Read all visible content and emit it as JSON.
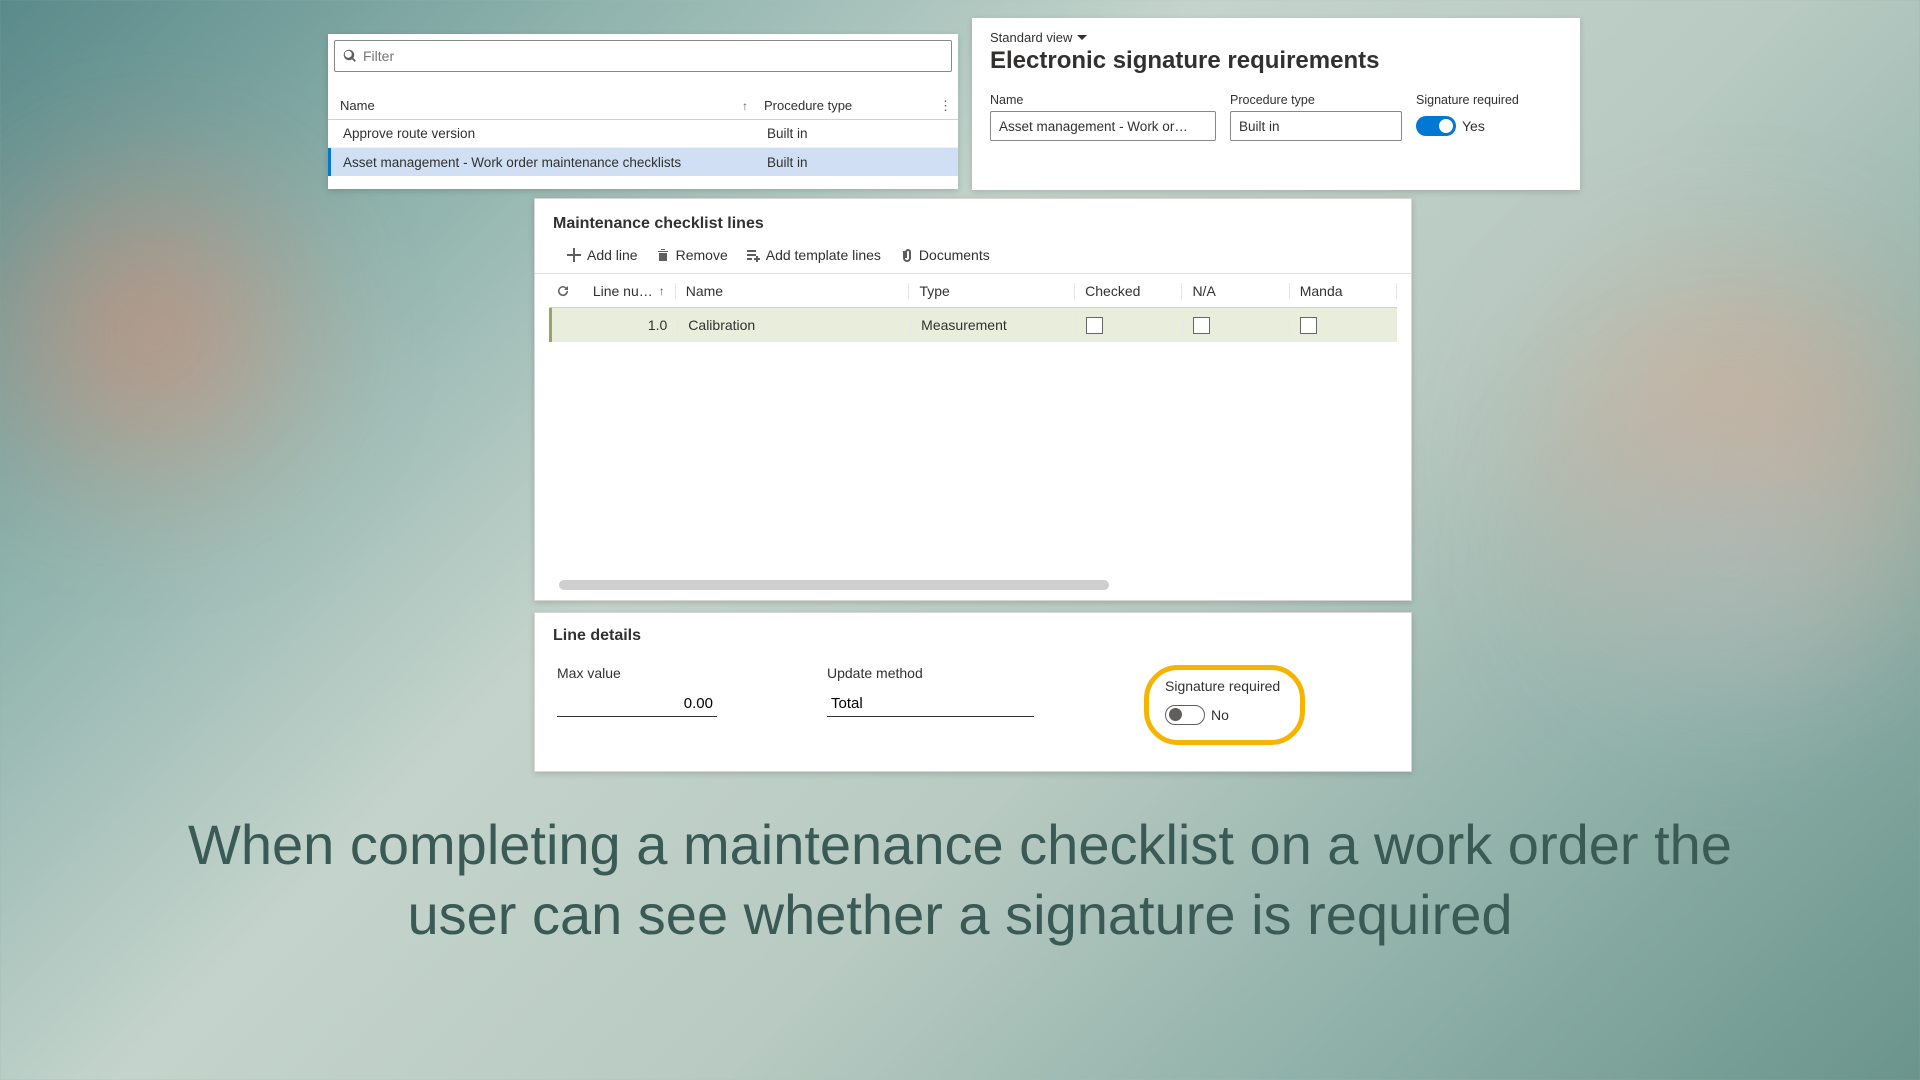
{
  "left": {
    "filter_placeholder": "Filter",
    "columns": {
      "name": "Name",
      "type": "Procedure type"
    },
    "rows": [
      {
        "name": "Approve route version",
        "type": "Built in"
      },
      {
        "name": "Asset management - Work order maintenance checklists",
        "type": "Built in"
      }
    ]
  },
  "right": {
    "view_label": "Standard view",
    "title": "Electronic signature requirements",
    "fields": {
      "name_label": "Name",
      "name_value": "Asset management - Work or…",
      "type_label": "Procedure type",
      "type_value": "Built in",
      "sig_label": "Signature required",
      "sig_state": "Yes"
    }
  },
  "mid": {
    "title": "Maintenance checklist lines",
    "toolbar": {
      "add_line": "Add line",
      "remove": "Remove",
      "add_template": "Add template lines",
      "documents": "Documents"
    },
    "columns": {
      "lineno": "Line nu…",
      "name": "Name",
      "type": "Type",
      "checked": "Checked",
      "na": "N/A",
      "mandatory": "Manda"
    },
    "rows": [
      {
        "lineno": "1.0",
        "name": "Calibration",
        "type": "Measurement",
        "checked": false,
        "na": false,
        "mandatory": false
      }
    ]
  },
  "line": {
    "title": "Line details",
    "max_label": "Max value",
    "max_value": "0.00",
    "update_label": "Update method",
    "update_value": "Total",
    "sig_label": "Signature required",
    "sig_state": "No"
  },
  "caption": "When completing a maintenance checklist on a work order the user can see whether a signature is required"
}
